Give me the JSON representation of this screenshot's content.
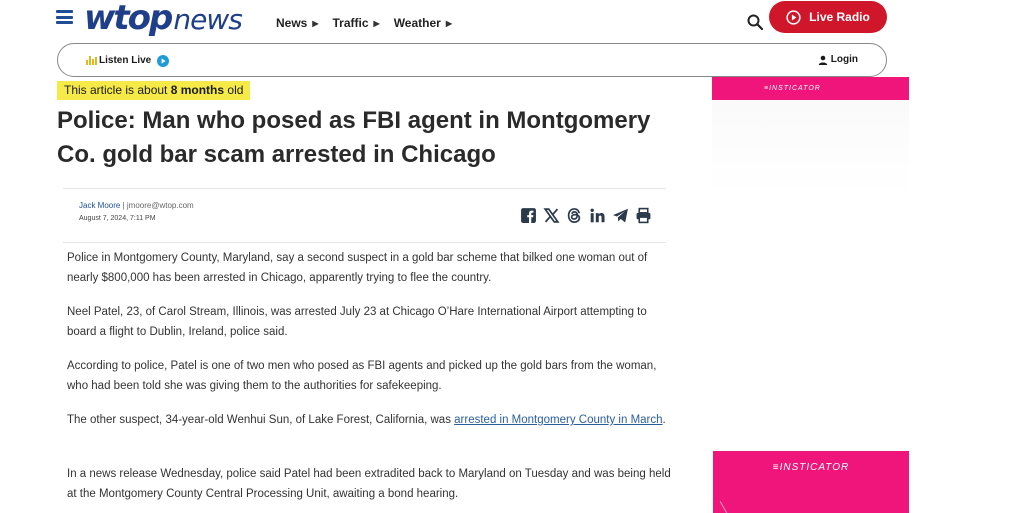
{
  "header": {
    "logo_wtop": "wtop",
    "logo_news": "news",
    "nav": [
      {
        "label": "News"
      },
      {
        "label": "Traffic"
      },
      {
        "label": "Weather"
      }
    ],
    "nav_arrow": "▶",
    "live_radio_label": "Live Radio"
  },
  "listen_bar": {
    "label": "Listen Live",
    "login_label": "Login"
  },
  "article": {
    "age_prefix": "This article is about ",
    "age_value": "8 months",
    "age_suffix": " old",
    "headline": "Police: Man who posed as FBI agent in Montgomery Co. gold bar scam arrested in Chicago",
    "author_name": "Jack Moore",
    "author_email": " | jmoore@wtop.com",
    "date": "August 7, 2024, 7:11 PM",
    "paragraphs": [
      "Police in Montgomery County, Maryland, say a second suspect in a gold bar scheme that bilked one woman out of nearly $800,000 has been arrested in Chicago, apparently trying to flee the country.",
      "Neel Patel, 23, of Carol Stream, Illinois, was arrested July 23 at Chicago O’Hare International Airport attempting to board a flight to Dublin, Ireland, police said.",
      "According to police, Patel is one of two men who posed as FBI agents and picked up the gold bars from the woman, who had been told she was giving them to the authorities for safekeeping."
    ],
    "p4_text": "The other suspect, 34-year-old Wenhui Sun, of Lake Forest, California, was ",
    "p4_link": "arrested in Montgomery County in March",
    "p4_end": ".",
    "p5": "In a news release Wednesday, police said Patel had been extradited back to Maryland on Tuesday and was being held at the Montgomery County Central Processing Unit, awaiting a bond hearing."
  },
  "ads": {
    "top_label": "≡INSTICATOR",
    "bottom_label": "≡INSTICATOR"
  },
  "colors": {
    "brand_blue": "#1f3f8a",
    "live_red": "#d0162a",
    "age_yellow": "#f6ea48",
    "ad_pink": "#f0157a",
    "link_blue": "#2a5f9e"
  },
  "icons": {
    "menu": "hamburger-icon",
    "search": "search-icon",
    "play": "play-circle-icon",
    "audio": "audio-bars-icon",
    "user": "user-icon",
    "share": [
      "facebook-icon",
      "x-icon",
      "threads-icon",
      "linkedin-icon",
      "telegram-icon",
      "print-icon"
    ]
  }
}
